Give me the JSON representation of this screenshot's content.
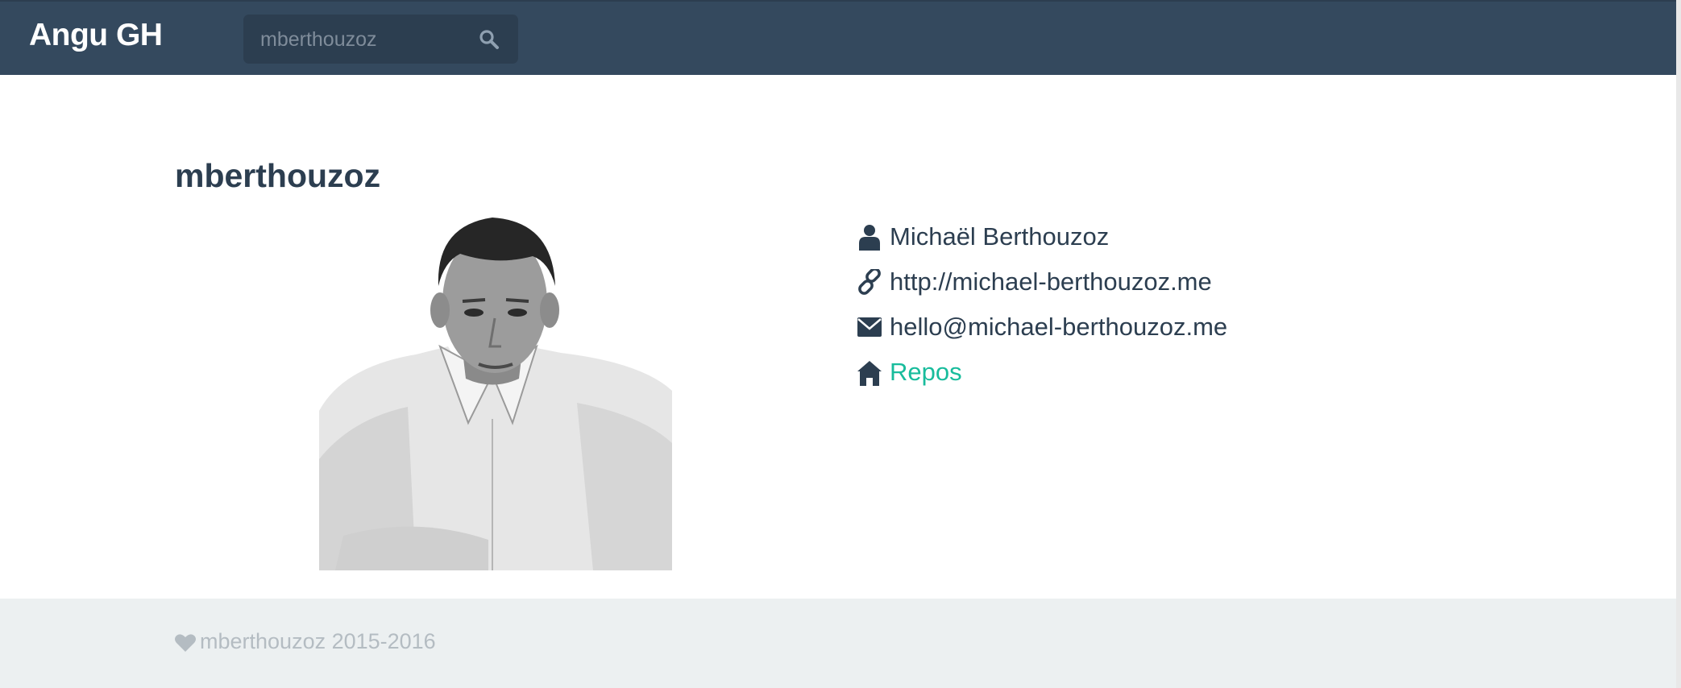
{
  "navbar": {
    "brand": "Angu GH",
    "search": {
      "value": "mberthouzoz",
      "placeholder": "mberthouzoz",
      "icon": "search-icon"
    }
  },
  "profile": {
    "username": "mberthouzoz",
    "avatar_icon": "user-avatar-photo",
    "info": [
      {
        "icon": "user-icon",
        "text": "Michaël Berthouzoz"
      },
      {
        "icon": "link-icon",
        "text": "http://michael-berthouzoz.me"
      },
      {
        "icon": "envelope-icon",
        "text": "hello@michael-berthouzoz.me"
      },
      {
        "icon": "home-icon",
        "text": "Repos"
      }
    ]
  },
  "footer": {
    "icon": "heart-icon",
    "text": "mberthouzoz 2015-2016"
  },
  "colors": {
    "navbar": "#34495e",
    "search_bg": "#2c3e50",
    "text": "#2c3e50",
    "link": "#18bc9c",
    "footer_bg": "#ecf0f1",
    "footer_text": "#b4bcc2"
  }
}
